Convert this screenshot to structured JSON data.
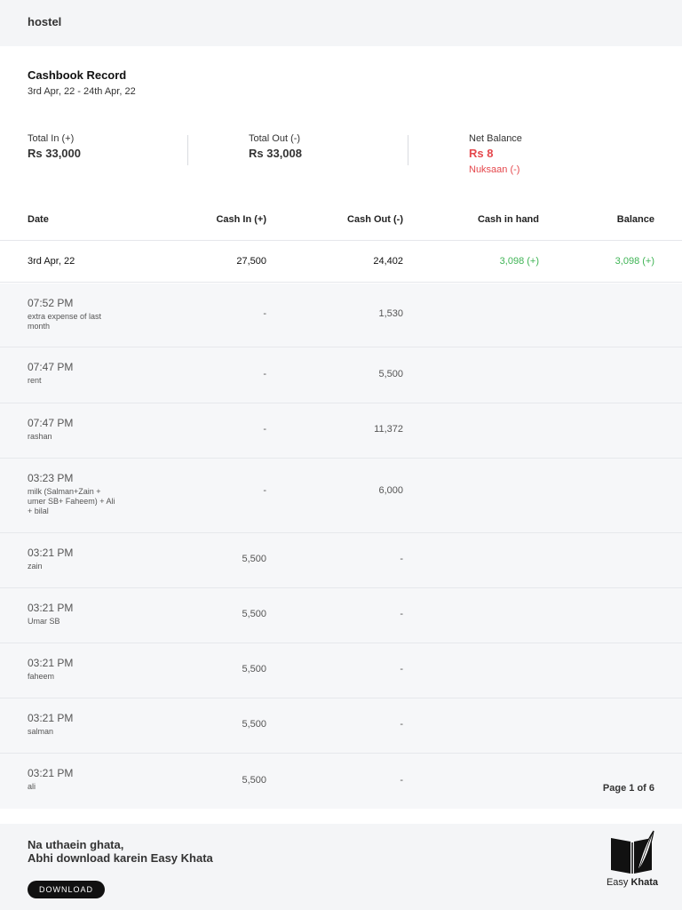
{
  "header": {
    "title": "hostel"
  },
  "record": {
    "title": "Cashbook Record",
    "date_range": "3rd Apr, 22 - 24th Apr, 22"
  },
  "summary": {
    "total_in_label": "Total In (+)",
    "total_in_value": "Rs 33,000",
    "total_out_label": "Total Out (-)",
    "total_out_value": "Rs 33,008",
    "net_label": "Net Balance",
    "net_value": "Rs 8",
    "net_note": "Nuksaan (-)",
    "net_color": "#e5484d"
  },
  "table": {
    "columns": [
      "Date",
      "Cash In (+)",
      "Cash Out (-)",
      "Cash in hand",
      "Balance"
    ],
    "day": {
      "date": "3rd Apr, 22",
      "cash_in": "27,500",
      "cash_out": "24,402",
      "cash_in_hand": "3,098 (+)",
      "balance": "3,098 (+)"
    },
    "entries": [
      {
        "time": "07:52 PM",
        "desc": "extra expense of last month",
        "cash_in": "-",
        "cash_out": "1,530"
      },
      {
        "time": "07:47 PM",
        "desc": "rent",
        "cash_in": "-",
        "cash_out": "5,500"
      },
      {
        "time": "07:47 PM",
        "desc": "rashan",
        "cash_in": "-",
        "cash_out": "11,372"
      },
      {
        "time": "03:23 PM",
        "desc": "milk (Salman+Zain + umer SB+ Faheem) + Ali + bilal",
        "cash_in": "-",
        "cash_out": "6,000"
      },
      {
        "time": "03:21 PM",
        "desc": "zain",
        "cash_in": "5,500",
        "cash_out": "-"
      },
      {
        "time": "03:21 PM",
        "desc": "Umar SB",
        "cash_in": "5,500",
        "cash_out": "-"
      },
      {
        "time": "03:21 PM",
        "desc": "faheem",
        "cash_in": "5,500",
        "cash_out": "-"
      },
      {
        "time": "03:21 PM",
        "desc": "salman",
        "cash_in": "5,500",
        "cash_out": "-"
      },
      {
        "time": "03:21 PM",
        "desc": "ali",
        "cash_in": "5,500",
        "cash_out": "-"
      }
    ],
    "positive_color": "#3fb455"
  },
  "pagination": {
    "label": "Page 1 of 6"
  },
  "footer": {
    "line1": "Na uthaein ghata,",
    "line2": "Abhi download karein Easy Khata",
    "download_label": "DOWNLOAD",
    "brand_light": "Easy",
    "brand_bold": "Khata",
    "logo_icon": "book-feather-icon"
  }
}
